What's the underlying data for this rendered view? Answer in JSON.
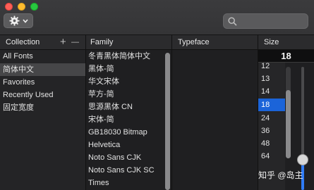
{
  "window": {
    "traffic_lights": [
      "close",
      "minimize",
      "zoom"
    ]
  },
  "toolbar": {
    "action_icon": "gear-icon",
    "action_chevron": "chevron-down-icon",
    "search_icon": "search-icon",
    "search_placeholder": ""
  },
  "headers": {
    "collection": "Collection",
    "add": "+",
    "remove": "—",
    "family": "Family",
    "typeface": "Typeface",
    "size": "Size"
  },
  "collections": [
    {
      "label": "All Fonts",
      "selected": false
    },
    {
      "label": "简体中文",
      "selected": true
    },
    {
      "label": "Favorites",
      "selected": false
    },
    {
      "label": "Recently Used",
      "selected": false
    },
    {
      "label": "固定宽度",
      "selected": false
    }
  ],
  "families": [
    "冬青黑体简体中文",
    "黑体-简",
    "华文宋体",
    "苹方-简",
    "思源黑体 CN",
    "宋体-简",
    "GB18030 Bitmap",
    "Helvetica",
    "Noto Sans CJK",
    "Noto Sans CJK SC",
    "Times"
  ],
  "size": {
    "current": "18",
    "options": [
      "12",
      "13",
      "14",
      "18",
      "24",
      "36",
      "48",
      "64"
    ],
    "selected": "18"
  },
  "watermark": "知乎 @岛主",
  "colors": {
    "selection_blue": "#1b64d9",
    "slider_blue": "#2f7bf5"
  }
}
